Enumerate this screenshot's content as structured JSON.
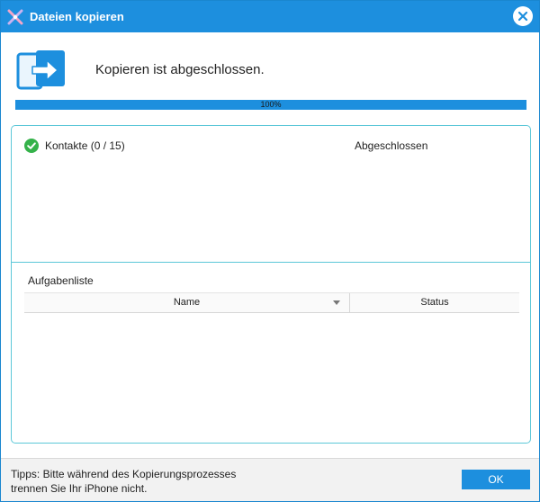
{
  "window": {
    "title": "Dateien kopieren"
  },
  "header": {
    "message": "Kopieren ist abgeschlossen.",
    "icon": "device-transfer-icon"
  },
  "progress": {
    "label": "100%",
    "value": 1.0
  },
  "items": [
    {
      "label": "Kontakte (0 / 15)",
      "status": "Abgeschlossen",
      "icon": "check-circle-icon"
    }
  ],
  "tasklist": {
    "title": "Aufgabenliste",
    "columns": {
      "name": "Name",
      "status": "Status"
    }
  },
  "footer": {
    "tips_line1": "Tipps: Bitte während des Kopierungsprozesses",
    "tips_line2": "trennen Sie Ihr iPhone nicht.",
    "ok_label": "OK"
  },
  "colors": {
    "accent": "#1d8fde",
    "panel_border": "#5cc7d8",
    "success": "#35b24a"
  }
}
